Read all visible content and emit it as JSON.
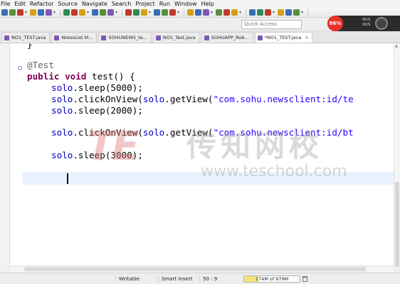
{
  "menu": [
    "File",
    "Edit",
    "Refactor",
    "Source",
    "Navigate",
    "Search",
    "Project",
    "Run",
    "Window",
    "Help"
  ],
  "toolbar": {
    "icon_colors": [
      "#3a6db5",
      "#5a8f3a",
      "#c0392b",
      "#d4a017",
      "#3a6db5",
      "#7b59b8",
      "#2e8b57",
      "#c0392b",
      "#d4a017",
      "#3a6db5",
      "#5a8f3a",
      "#7b59b8",
      "#c0392b",
      "#2e8b57",
      "#d4a017",
      "#3a6db5",
      "#5a8f3a",
      "#c0392b",
      "#d4a017",
      "#3a6db5",
      "#7b59b8",
      "#5a8f3a",
      "#c0392b",
      "#d4a017",
      "#3a6db5",
      "#2e8b57",
      "#c0392b",
      "#d4a017",
      "#3a6db5",
      "#5a8f3a"
    ]
  },
  "quick_access": {
    "placeholder": "Quick Access"
  },
  "recorder": {
    "percent": "86%",
    "stat1": "0K/S",
    "stat2": "0K/S"
  },
  "tabs": [
    {
      "label": "NO1_TEST.java",
      "active": false
    },
    {
      "label": "NotesList M...",
      "active": false
    },
    {
      "label": "SOHUNEWS_te...",
      "active": false
    },
    {
      "label": "NO1_Test.java",
      "active": false
    },
    {
      "label": "SOHUAPP_Rob...",
      "active": false
    },
    {
      "label": "*NO1_TEST.java",
      "active": true
    }
  ],
  "code": {
    "l0": "}",
    "ann": "@Test",
    "sig_kw1": "public",
    "sig_kw2": "void",
    "sig_rest": " test() {",
    "solo": "solo",
    "sleep1": ".sleep(5000);",
    "click1_a": ".clickOnView(",
    "click1_b": ".getView(",
    "click1_str": "\"com.sohu.newsclient:id/te",
    "sleep2": ".sleep(2000);",
    "click2_str": "\"com.sohu.newsclient:id/bt",
    "sleep3": ".sleep(3000);"
  },
  "watermark": {
    "logo": "TE",
    "cn": "传知网校",
    "url": "www.teschool.com"
  },
  "status": {
    "writable": "Writable",
    "insert": "Smart Insert",
    "position": "50 : 9",
    "heap": "174M of 679M",
    "heap_used_mb": 174,
    "heap_total_mb": 679
  },
  "colors": {
    "keyword": "#7f0055",
    "string": "#2a00ff",
    "field": "#0000c0",
    "annotation": "#646464",
    "current_line": "#e8f2fe"
  }
}
